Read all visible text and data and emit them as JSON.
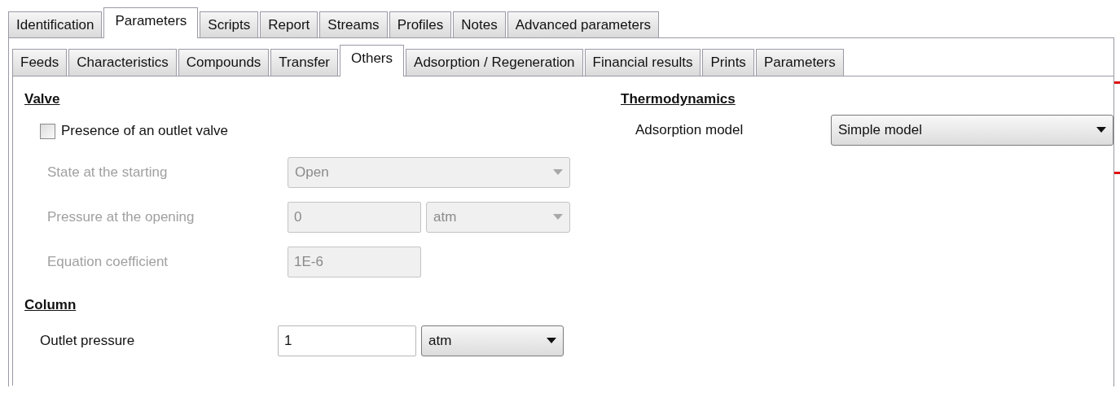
{
  "tabs": [
    {
      "label": "Identification",
      "selected": false
    },
    {
      "label": "Parameters",
      "selected": true
    },
    {
      "label": "Scripts",
      "selected": false
    },
    {
      "label": "Report",
      "selected": false
    },
    {
      "label": "Streams",
      "selected": false
    },
    {
      "label": "Profiles",
      "selected": false
    },
    {
      "label": "Notes",
      "selected": false
    },
    {
      "label": "Advanced parameters",
      "selected": false
    }
  ],
  "subtabs": [
    {
      "label": "Feeds",
      "selected": false
    },
    {
      "label": "Characteristics",
      "selected": false
    },
    {
      "label": "Compounds",
      "selected": false
    },
    {
      "label": "Transfer",
      "selected": false
    },
    {
      "label": "Others",
      "selected": true
    },
    {
      "label": "Adsorption / Regeneration",
      "selected": false
    },
    {
      "label": "Financial results",
      "selected": false
    },
    {
      "label": "Prints",
      "selected": false
    },
    {
      "label": "Parameters",
      "selected": false
    }
  ],
  "valve": {
    "title": "Valve",
    "outlet_valve": {
      "label": "Presence of an outlet valve",
      "checked": false
    },
    "rows": [
      {
        "kind": "dropdown",
        "label": "State at the starting",
        "value": "Open",
        "disabled": true
      },
      {
        "kind": "unit",
        "label": "Pressure at the opening",
        "value": "0",
        "unit": "atm",
        "disabled": true
      },
      {
        "kind": "text",
        "label": "Equation coefficient",
        "value": "1E-6",
        "disabled": true
      }
    ]
  },
  "column": {
    "title": "Column",
    "rows": [
      {
        "kind": "unit",
        "label": "Outlet pressure",
        "value": "1",
        "unit": "atm",
        "disabled": false
      }
    ]
  },
  "thermodynamics": {
    "title": "Thermodynamics",
    "rows": [
      {
        "kind": "dropdown",
        "label": "Adsorption model",
        "value": "Simple model",
        "disabled": false
      }
    ]
  }
}
